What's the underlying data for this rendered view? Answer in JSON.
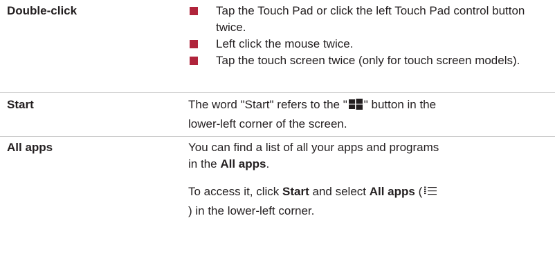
{
  "rows": [
    {
      "term": "Double-click",
      "bullets": [
        "Tap the Touch Pad or click the left Touch Pad control button twice.",
        "Left click the mouse twice.",
        "Tap the touch screen twice (only for touch screen models)."
      ]
    },
    {
      "term": "Start",
      "def_part1": "The word \"Start\" refers to the \"",
      "def_part2": "\" button in the",
      "def_line2": "lower-left corner of the screen."
    },
    {
      "term": "All apps",
      "p1_line1": "You can find a list of all your apps and programs",
      "p1_line2_pre": "in the ",
      "p1_line2_bold": "All apps",
      "p1_line2_post": ".",
      "p2_pre": "To access it, click ",
      "p2_bold1": "Start",
      "p2_mid": " and select ",
      "p2_bold2": "All apps",
      "p2_paren": " (",
      "p2_line2": ") in the lower-left corner."
    }
  ],
  "colors": {
    "text": "#231f20",
    "bullet": "#b0243b",
    "rule": "#b7b7b7"
  },
  "icons": {
    "windows_logo": "windows-logo-icon",
    "all_apps": "all-apps-list-icon"
  }
}
